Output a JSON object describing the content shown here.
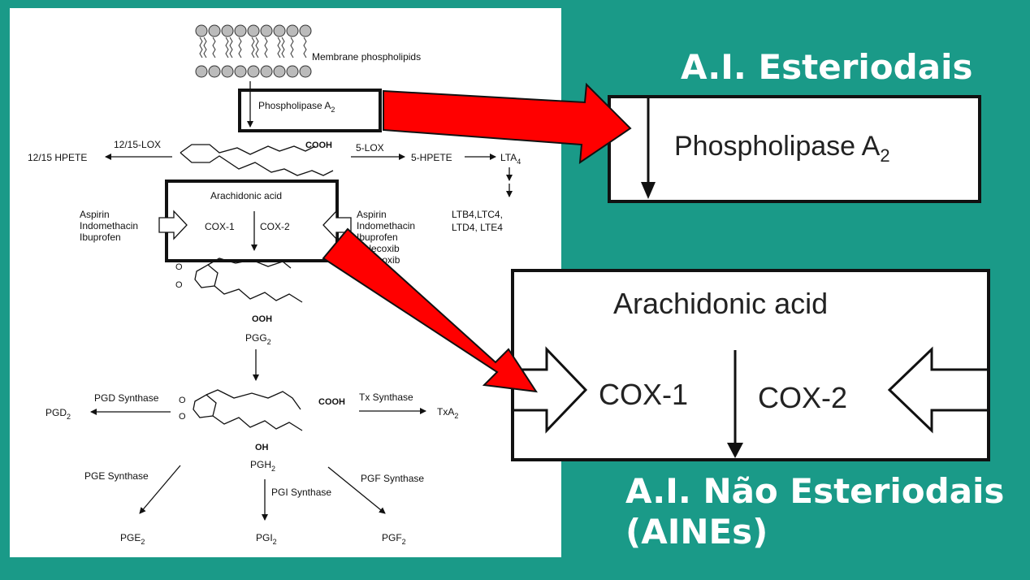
{
  "diagram": {
    "membrane": "Membrane phospholipids",
    "pla2": "Phospholipase A",
    "pla2_sub": "2",
    "lox1215": "12/15-LOX",
    "hpete1215": "12/15 HPETE",
    "cooh": "COOH",
    "lox5": "5-LOX",
    "hpete5": "5-HPETE",
    "lta4": "LTA",
    "lta4_sub": "4",
    "ltb4": "LTB",
    "lt_row1": "LTB4,LTC4,",
    "lt_row2": "LTD4, LTE4",
    "arachidonic": "Arachidonic acid",
    "cox1": "COX-1",
    "cox2": "COX-2",
    "left_drugs": [
      "Aspirin",
      "Indomethacin",
      "Ibuprofen"
    ],
    "right_drugs": [
      "Aspirin",
      "Indomethacin",
      "Ibuprofen",
      "Celecoxib",
      "Rofecoxib"
    ],
    "ooh": "OOH",
    "pgg2": "PGG",
    "sub2": "2",
    "pgd_synthase": "PGD Synthase",
    "pgd2": "PGD",
    "tx_synthase": "Tx Synthase",
    "txa2": "TxA",
    "oh": "OH",
    "pgh2": "PGH",
    "pge_synthase": "PGE Synthase",
    "pgi_synthase": "PGI Synthase",
    "pgf_synthase": "PGF Synthase",
    "pge2": "PGE",
    "pgi2": "PGI",
    "pgf2": "PGF"
  },
  "headings": {
    "steroidal": "A.I. Esteriodais",
    "nonsteroidal_line1": "A.I. Não Esteriodais",
    "nonsteroidal_line2": "(AINEs)"
  },
  "zoom_top": {
    "label": "Phospholipase A",
    "sub": "2"
  },
  "zoom_bottom": {
    "title": "Arachidonic acid",
    "cox1": "COX-1",
    "cox2": "COX-2"
  },
  "colors": {
    "background": "#1a9a88",
    "arrow": "#ff0000",
    "panel": "#ffffff"
  }
}
